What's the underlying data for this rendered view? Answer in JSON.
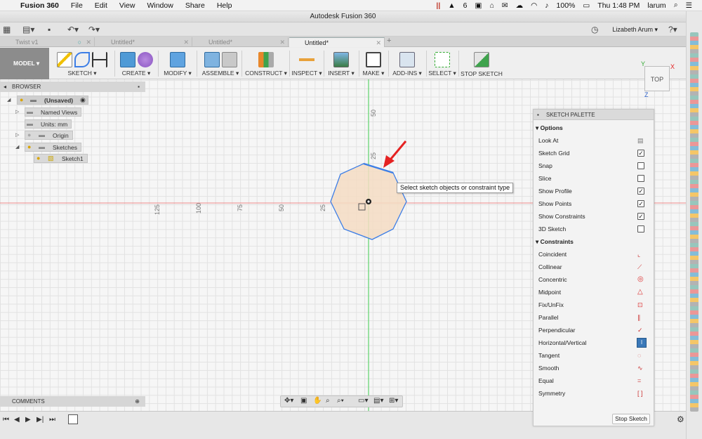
{
  "menubar": {
    "app_name": "Fusion 360",
    "items": [
      "File",
      "Edit",
      "View",
      "Window",
      "Share",
      "Help"
    ],
    "status": {
      "badge_count": "6",
      "battery": "100%",
      "clock": "Thu 1:48 PM",
      "user": "larum"
    }
  },
  "window": {
    "title": "Autodesk Fusion 360"
  },
  "toolbar": {
    "user_name": "Lizabeth Arum"
  },
  "tabs": [
    {
      "label": "Twist v1"
    },
    {
      "label": "Untitled*"
    },
    {
      "label": "Untitled*"
    },
    {
      "label": "Untitled*"
    }
  ],
  "ribbon": {
    "workspace": "MODEL",
    "groups": [
      {
        "label": "SKETCH"
      },
      {
        "label": "CREATE"
      },
      {
        "label": "MODIFY"
      },
      {
        "label": "ASSEMBLE"
      },
      {
        "label": "CONSTRUCT"
      },
      {
        "label": "INSPECT"
      },
      {
        "label": "INSERT"
      },
      {
        "label": "MAKE"
      },
      {
        "label": "ADD-INS"
      },
      {
        "label": "SELECT"
      },
      {
        "label": "STOP SKETCH"
      }
    ]
  },
  "browser": {
    "title": "BROWSER",
    "items": [
      {
        "label": "(Unsaved)"
      },
      {
        "label": "Named Views"
      },
      {
        "label": "Units: mm"
      },
      {
        "label": "Origin"
      },
      {
        "label": "Sketches"
      },
      {
        "label": "Sketch1"
      }
    ]
  },
  "canvas": {
    "ruler_vertical": [
      "50",
      "25"
    ],
    "ruler_horizontal": [
      "125",
      "100",
      "75",
      "50",
      "25"
    ],
    "tooltip": "Select sketch objects or constraint type",
    "viewcube": {
      "face": "TOP",
      "axis_x": "X",
      "axis_y": "Y",
      "axis_z": "Z"
    }
  },
  "palette": {
    "title": "SKETCH PALETTE",
    "options_header": "Options",
    "options": [
      {
        "label": "Look At",
        "control": "button"
      },
      {
        "label": "Sketch Grid",
        "checked": true
      },
      {
        "label": "Snap",
        "checked": false
      },
      {
        "label": "Slice",
        "checked": false
      },
      {
        "label": "Show Profile",
        "checked": true
      },
      {
        "label": "Show Points",
        "checked": true
      },
      {
        "label": "Show Constraints",
        "checked": true
      },
      {
        "label": "3D Sketch",
        "checked": false
      }
    ],
    "constraints_header": "Constraints",
    "constraints": [
      {
        "label": "Coincident",
        "icon": "coincident-icon"
      },
      {
        "label": "Collinear",
        "icon": "collinear-icon"
      },
      {
        "label": "Concentric",
        "icon": "concentric-icon"
      },
      {
        "label": "Midpoint",
        "icon": "midpoint-icon"
      },
      {
        "label": "Fix/UnFix",
        "icon": "lock-icon"
      },
      {
        "label": "Parallel",
        "icon": "parallel-icon"
      },
      {
        "label": "Perpendicular",
        "icon": "perpendicular-icon"
      },
      {
        "label": "Horizontal/Vertical",
        "icon": "horizontal-vertical-icon",
        "active": true
      },
      {
        "label": "Tangent",
        "icon": "tangent-icon"
      },
      {
        "label": "Smooth",
        "icon": "smooth-icon"
      },
      {
        "label": "Equal",
        "icon": "equal-icon"
      },
      {
        "label": "Symmetry",
        "icon": "symmetry-icon"
      }
    ],
    "stop_button": "Stop Sketch"
  },
  "comments": {
    "title": "COMMENTS"
  },
  "colors": {
    "accent_red": "#e52222",
    "sketch_line": "#3d7ee6",
    "profile_fill": "#f5dcc3",
    "active_constraint": "#3a78b8"
  }
}
